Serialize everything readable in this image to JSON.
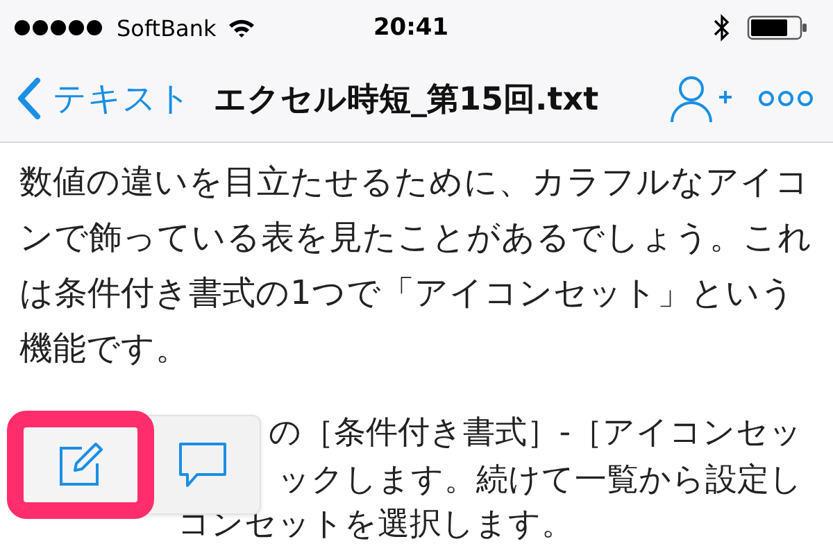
{
  "status_bar": {
    "carrier": "SoftBank",
    "time": "20:41"
  },
  "nav_bar": {
    "back_label": "テキスト",
    "title": "エクセル時短_第15回.txt"
  },
  "document": {
    "paragraph": "数値の違いを目立たせるために、カラフルなアイコンで飾っている表を見たことがあるでしょう。これは条件付き書式の1つで「アイコンセット」という機能です。",
    "partly_covered_lines": [
      "の［条件付き書式］-［アイコンセッ",
      "ックします。続けて一覧から設定し",
      "コンセットを選択します。"
    ]
  },
  "popup": {
    "buttons": [
      {
        "kind": "edit",
        "highlighted": true
      },
      {
        "kind": "comment",
        "highlighted": false
      }
    ]
  }
}
